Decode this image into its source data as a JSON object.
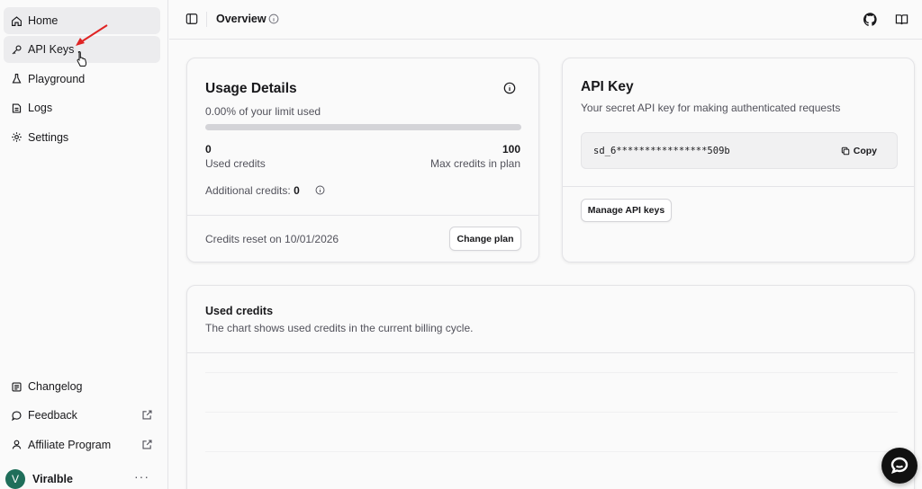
{
  "sidebar": {
    "items": [
      {
        "label": "Home",
        "icon": "home-icon"
      },
      {
        "label": "API Keys",
        "icon": "key-icon"
      },
      {
        "label": "Playground",
        "icon": "flask-icon"
      },
      {
        "label": "Logs",
        "icon": "logs-icon"
      },
      {
        "label": "Settings",
        "icon": "gear-icon"
      }
    ],
    "bottom_items": [
      {
        "label": "Changelog",
        "icon": "changelog-icon"
      },
      {
        "label": "Feedback",
        "icon": "chat-icon"
      },
      {
        "label": "Affiliate Program",
        "icon": "user-icon"
      }
    ],
    "user": {
      "initial": "V",
      "name": "Viralble",
      "menu": "···"
    }
  },
  "topbar": {
    "title": "Overview"
  },
  "usage": {
    "title": "Usage Details",
    "percent_text": "0.00% of your limit used",
    "progress": 0,
    "used_value": "0",
    "used_label": "Used credits",
    "max_value": "100",
    "max_label": "Max credits in plan",
    "additional_label": "Additional credits:",
    "additional_value": "0",
    "reset_text": "Credits reset on 10/01/2026",
    "change_plan_label": "Change plan"
  },
  "api_key": {
    "title": "API Key",
    "subtitle": "Your secret API key for making authenticated requests",
    "masked_key": "sd_6****************509b",
    "copy_label": "Copy",
    "manage_label": "Manage API keys"
  },
  "used_credits": {
    "title": "Used credits",
    "subtitle": "The chart shows used credits in the current billing cycle."
  },
  "colors": {
    "annotation_arrow": "#e02424",
    "avatar": "#1f6e5a"
  }
}
